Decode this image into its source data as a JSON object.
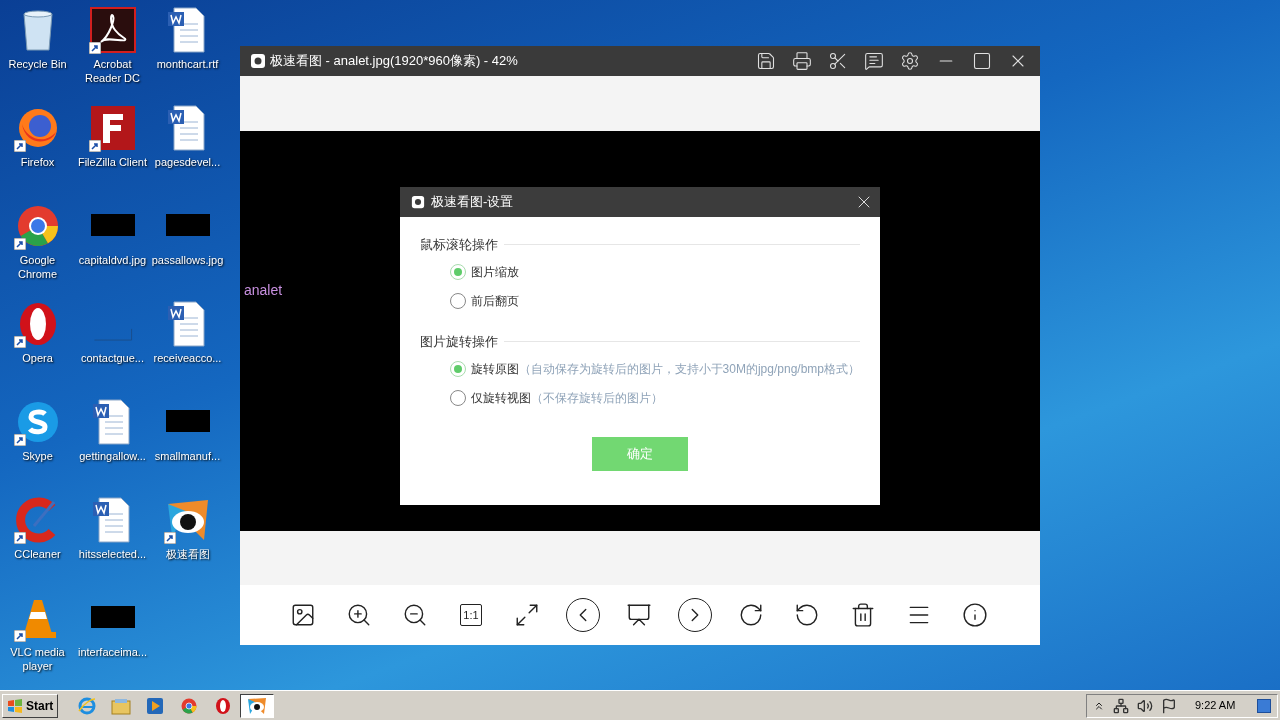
{
  "desktop": {
    "icons": [
      {
        "label": "Recycle Bin",
        "kind": "recycle",
        "shortcut": false
      },
      {
        "label": "Firefox",
        "kind": "firefox",
        "shortcut": true
      },
      {
        "label": "Google Chrome",
        "kind": "chrome",
        "shortcut": true
      },
      {
        "label": "Opera",
        "kind": "opera",
        "shortcut": true
      },
      {
        "label": "Skype",
        "kind": "skype",
        "shortcut": true
      },
      {
        "label": "CCleaner",
        "kind": "ccleaner",
        "shortcut": true
      },
      {
        "label": "VLC media player",
        "kind": "vlc",
        "shortcut": true
      },
      {
        "label": "Acrobat Reader DC",
        "kind": "acrobat",
        "shortcut": true
      },
      {
        "label": "FileZilla Client",
        "kind": "filezilla",
        "shortcut": true
      },
      {
        "label": "capitaldvd.jpg",
        "kind": "thumb",
        "shortcut": false
      },
      {
        "label": "contactgue...",
        "kind": "blank",
        "shortcut": false
      },
      {
        "label": "gettingallow...",
        "kind": "doc",
        "shortcut": false
      },
      {
        "label": "hitsselected...",
        "kind": "doc",
        "shortcut": false
      },
      {
        "label": "interfaceima...",
        "kind": "thumb",
        "shortcut": false
      },
      {
        "label": "monthcart.rtf",
        "kind": "doc",
        "shortcut": false
      },
      {
        "label": "pagesdevel...",
        "kind": "doc",
        "shortcut": false
      },
      {
        "label": "passallows.jpg",
        "kind": "thumb",
        "shortcut": false
      },
      {
        "label": "receiveacco...",
        "kind": "doc",
        "shortcut": false
      },
      {
        "label": "smallmanuf...",
        "kind": "thumb",
        "shortcut": false
      },
      {
        "label": "极速看图",
        "kind": "eye",
        "shortcut": true
      }
    ]
  },
  "window": {
    "title": "极速看图 - analet.jpg(1920*960像素) - 42%",
    "image_alt": "analet",
    "toolbar": [
      {
        "kind": "picture"
      },
      {
        "kind": "zoom-in"
      },
      {
        "kind": "zoom-out"
      },
      {
        "kind": "actual-size",
        "label": "1:1"
      },
      {
        "kind": "fit"
      },
      {
        "kind": "previous"
      },
      {
        "kind": "slideshow"
      },
      {
        "kind": "next"
      },
      {
        "kind": "rotate-cw"
      },
      {
        "kind": "rotate-ccw"
      },
      {
        "kind": "delete"
      },
      {
        "kind": "menu"
      },
      {
        "kind": "info"
      }
    ]
  },
  "dialog": {
    "title": "极速看图-设置",
    "sections": [
      {
        "title": "鼠标滚轮操作",
        "options": [
          {
            "label": "图片缩放",
            "selected": true
          },
          {
            "label": "前后翻页",
            "selected": false
          }
        ]
      },
      {
        "title": "图片旋转操作",
        "options": [
          {
            "label": "旋转原图",
            "note": "（自动保存为旋转后的图片，支持小于30M的jpg/png/bmp格式）",
            "selected": true
          },
          {
            "label": "仅旋转视图",
            "note": "（不保存旋转后的图片）",
            "selected": false
          }
        ]
      }
    ],
    "confirm": "确定"
  },
  "taskbar": {
    "start": "Start",
    "apps": [
      {
        "kind": "ie",
        "selected": false
      },
      {
        "kind": "explorer",
        "selected": false
      },
      {
        "kind": "media",
        "selected": false
      },
      {
        "kind": "chrome",
        "selected": false
      },
      {
        "kind": "opera",
        "selected": false
      },
      {
        "kind": "viewer",
        "selected": true
      }
    ],
    "clock": "9:22 AM"
  }
}
